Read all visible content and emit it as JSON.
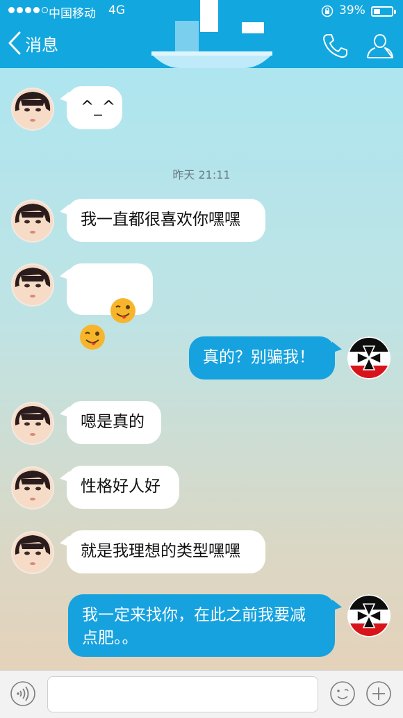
{
  "status_bar": {
    "carrier": "中国移动",
    "network": "4G",
    "battery": "39%",
    "battery_level": 0.39
  },
  "header": {
    "back_label": "消息"
  },
  "timestamp": "昨天 21:11",
  "messages": [
    {
      "side": "in",
      "text": "^_^"
    },
    {
      "side": "in",
      "text": "我一直都很喜欢你嘿嘿"
    },
    {
      "side": "in",
      "text": "",
      "emoji": [
        "wink-tongue-emoji",
        "wink-tongue-emoji"
      ]
    },
    {
      "side": "out",
      "text": "真的？别骗我！"
    },
    {
      "side": "in",
      "text": "嗯是真的"
    },
    {
      "side": "in",
      "text": "性格好人好"
    },
    {
      "side": "in",
      "text": "就是我理想的类型嘿嘿"
    },
    {
      "side": "out",
      "text": "我一定来找你，在此之前我要减点肥。。"
    }
  ],
  "input": {
    "placeholder": ""
  },
  "colors": {
    "header": "#13a7df",
    "outgoing_bubble": "#16a2de",
    "incoming_bubble": "#ffffff"
  }
}
